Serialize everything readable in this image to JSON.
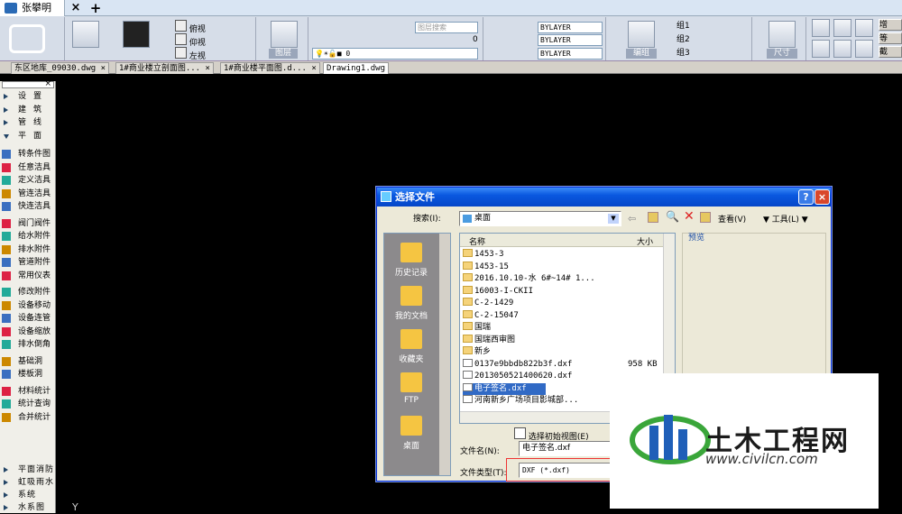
{
  "titlebar": {
    "app_tab": "张攀明",
    "close": "×",
    "new": "+"
  },
  "ribbon": {
    "view_labels": [
      "俯视",
      "仰视",
      "左视"
    ],
    "layer_group_label": "图层",
    "layer_search_placeholder": "图层搜索",
    "layer_slider_value": "0",
    "layer_current": "0",
    "bylayer": [
      "BYLAYER",
      "BYLAYER",
      "BYLAYER"
    ],
    "group_items": [
      "组1",
      "组2",
      "组3"
    ],
    "edit_label": "编组",
    "dim_label": "尺寸",
    "right_labels": [
      "增",
      "等",
      "截"
    ]
  },
  "doc_tabs": [
    "东区地库_09030.dwg",
    "1#商业楼立剖面图...",
    "1#商业楼平面图.d...",
    "Drawing1.dwg"
  ],
  "sidebar": {
    "header_close": "×",
    "categories": [
      "设置",
      "建筑",
      "管线",
      "平面"
    ],
    "items": [
      "转条件图",
      "任意洁具",
      "定义洁具",
      "管连洁具",
      "快连洁具",
      "阀门阀件",
      "给水附件",
      "排水附件",
      "管道附件",
      "常用仪表",
      "修改附件",
      "设备移动",
      "设备连管",
      "设备缩放",
      "排水倒角",
      "基础洞",
      "楼板洞",
      "材料统计",
      "统计查询",
      "合并统计"
    ],
    "bottom": [
      "平面消防",
      "虹吸雨水",
      "系统",
      "水系图"
    ]
  },
  "dialog": {
    "title": "选择文件",
    "search_label": "搜索(I):",
    "search_value": "桌面",
    "view_label": "查看(V)",
    "tools_label": "工具(L)",
    "preview_label": "预览",
    "col_name": "名称",
    "col_size": "大小",
    "places": [
      "历史记录",
      "我的文档",
      "收藏夹",
      "FTP",
      "桌面"
    ],
    "files": [
      {
        "name": "1453-3",
        "size": "",
        "type": "folder"
      },
      {
        "name": "1453-15",
        "size": "",
        "type": "folder"
      },
      {
        "name": "2016.10.10-水 6#~14# 1...",
        "size": "",
        "type": "folder"
      },
      {
        "name": "16003-I-CKII",
        "size": "",
        "type": "folder"
      },
      {
        "name": "C-2-1429",
        "size": "",
        "type": "folder"
      },
      {
        "name": "C-2-15047",
        "size": "",
        "type": "folder"
      },
      {
        "name": "国瑞",
        "size": "",
        "type": "folder"
      },
      {
        "name": "国瑞西审图",
        "size": "",
        "type": "folder"
      },
      {
        "name": "新乡",
        "size": "",
        "type": "folder"
      },
      {
        "name": "0137e9bbdb822b3f.dxf",
        "size": "958 KB",
        "type": "file"
      },
      {
        "name": "2013050521400620.dxf",
        "size": "",
        "type": "file"
      },
      {
        "name": "电子签名.dxf",
        "size": "",
        "type": "file"
      },
      {
        "name": "河南新乡广场项目影城部...",
        "size": "",
        "type": "file"
      }
    ],
    "initial_view_label": "选择初始视图(E)",
    "filename_label": "文件名(N):",
    "filename_value": "电子签名.dxf",
    "filetype_label": "文件类型(T):",
    "filetype_value": "DXF (*.dxf)"
  },
  "watermark": {
    "title": "土木工程网",
    "url": "www.civilcn.com"
  },
  "canvas": {
    "axis_y": "Y"
  },
  "colors": {
    "titlebar_blue": "#0a58e0",
    "selection": "#316ac5",
    "watermark_blue": "#1f5fb8",
    "watermark_green": "#3aa63a"
  }
}
